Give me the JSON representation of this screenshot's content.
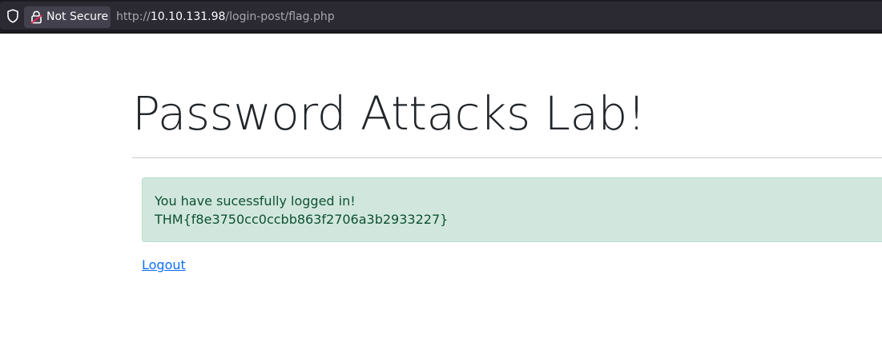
{
  "browser": {
    "security_label": "Not Secure",
    "url": {
      "scheme": "http://",
      "host": "10.10.131.98",
      "path": "/login-post/flag.php"
    }
  },
  "page": {
    "title": "Password Attacks Lab!",
    "alert": {
      "message": "You have sucessfully logged in!",
      "flag": "THM{f8e3750cc0ccbb863f2706a3b2933227}",
      "colors": {
        "background": "#d1e7dd",
        "border": "#badbcc",
        "text": "#0f5132"
      }
    },
    "logout_label": "Logout",
    "link_color": "#0d6efd"
  }
}
